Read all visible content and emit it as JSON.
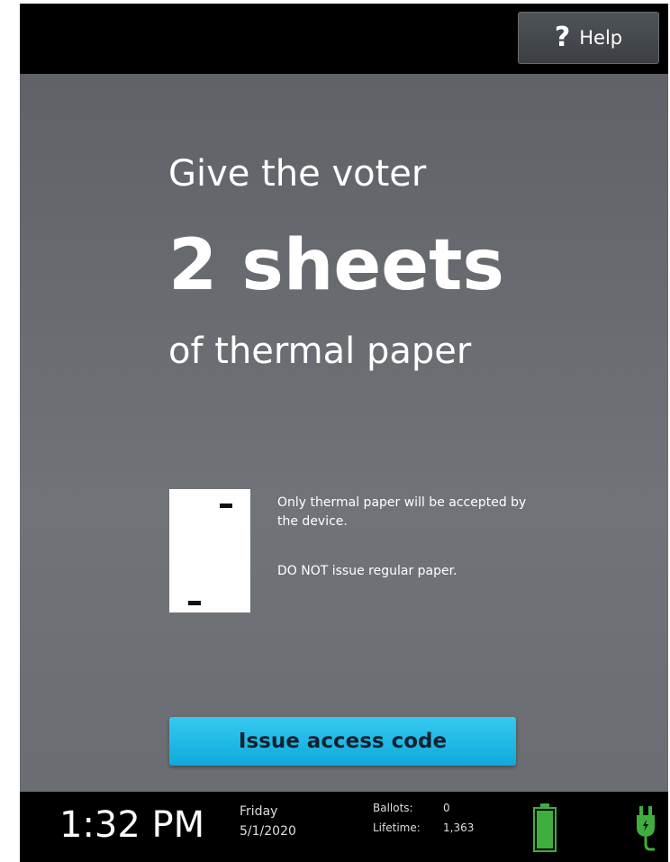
{
  "header": {
    "help_label": "Help",
    "help_icon": "question-mark-icon"
  },
  "main": {
    "line1": "Give the voter",
    "line2": "2 sheets",
    "line3": "of thermal paper",
    "note1": "Only thermal paper will be accepted by the device.",
    "note2": "DO NOT issue regular paper.",
    "paper_icon": "thermal-paper-icon",
    "issue_button_label": "Issue access code"
  },
  "status": {
    "time": "1:32 PM",
    "day": "Friday",
    "date": "5/1/2020",
    "ballots_label": "Ballots:",
    "ballots_value": "0",
    "lifetime_label": "Lifetime:",
    "lifetime_value": "1,363",
    "battery_icon": "battery-full-icon",
    "power_icon": "power-plug-icon"
  },
  "colors": {
    "accent": "#1fb8e6",
    "status_green": "#3fae3f"
  }
}
